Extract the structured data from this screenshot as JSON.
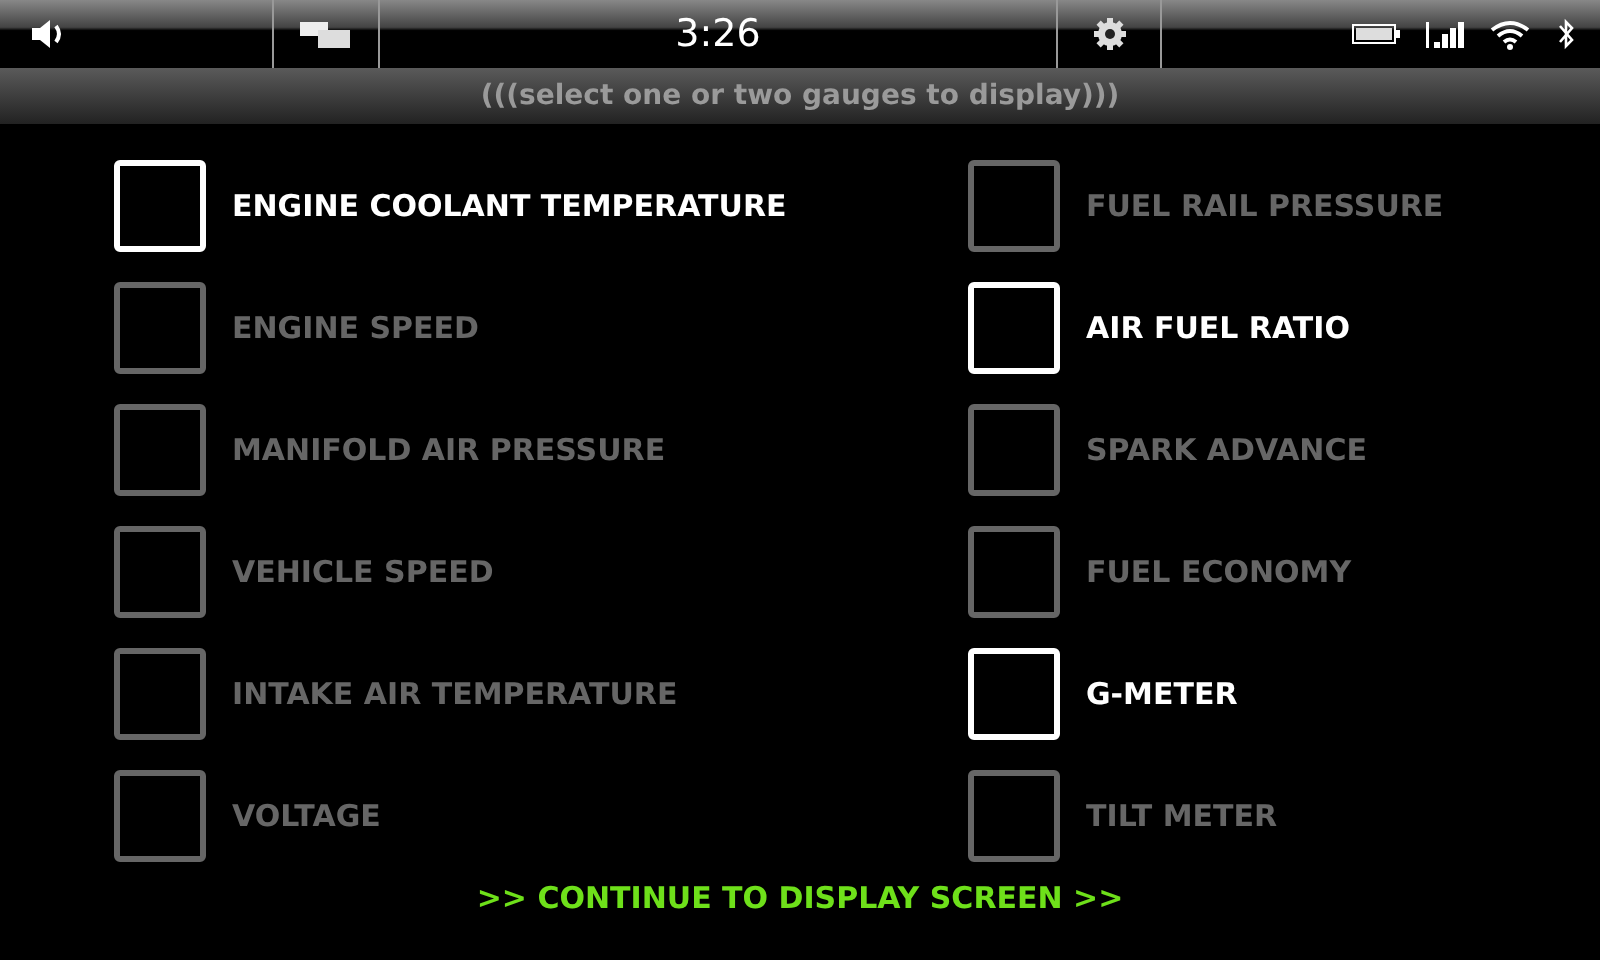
{
  "status_bar": {
    "time": "3:26"
  },
  "prompt": "(((select one or two gauges to display)))",
  "gauges": [
    {
      "label": "ENGINE COOLANT TEMPERATURE",
      "selected": true
    },
    {
      "label": "ENGINE SPEED",
      "selected": false
    },
    {
      "label": "MANIFOLD AIR PRESSURE",
      "selected": false
    },
    {
      "label": "VEHICLE SPEED",
      "selected": false
    },
    {
      "label": "INTAKE AIR TEMPERATURE",
      "selected": false
    },
    {
      "label": "VOLTAGE",
      "selected": false
    },
    {
      "label": "FUEL RAIL PRESSURE",
      "selected": false
    },
    {
      "label": "AIR FUEL RATIO",
      "selected": true
    },
    {
      "label": "SPARK ADVANCE",
      "selected": false
    },
    {
      "label": "FUEL ECONOMY",
      "selected": false
    },
    {
      "label": "G-METER",
      "selected": true
    },
    {
      "label": "TILT METER",
      "selected": false
    }
  ],
  "continue_button": ">> CONTINUE TO DISPLAY SCREEN >>"
}
